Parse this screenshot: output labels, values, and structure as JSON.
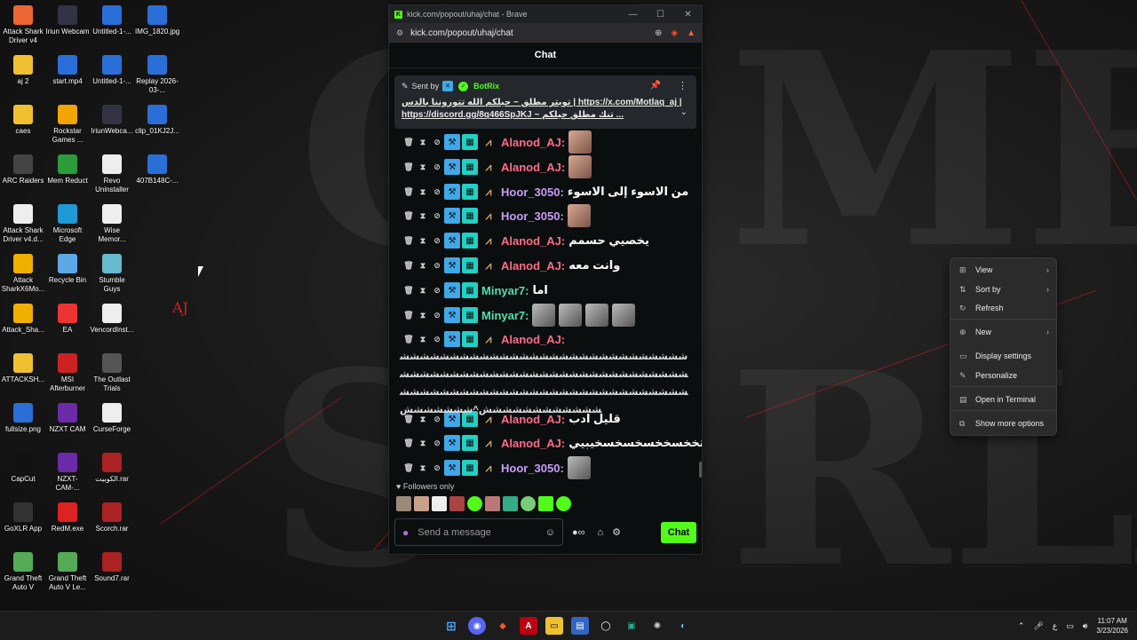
{
  "browser": {
    "title": "kick.com/popout/uhaj/chat - Brave",
    "url": "kick.com/popout/uhaj/chat",
    "minimize": "—",
    "maximize": "☐",
    "close": "✕"
  },
  "chat": {
    "header": "Chat",
    "pinned": {
      "sent_by": "Sent by",
      "bot_name": "BotRix",
      "line1": "تويتر مطلق ~ حيلكم الله تتوروننا بالدس | https://x.com/Motlaq_aj |",
      "line2": "https://discord.gg/8q466SpJKJ ~ تنك مطلق حيلكم ..."
    },
    "messages": [
      {
        "user": "Alanod_AJ:",
        "text": "",
        "emotes": 1,
        "color": "#ff6b8a"
      },
      {
        "user": "Alanod_AJ:",
        "text": "",
        "emotes": 1,
        "color": "#ff6b8a"
      },
      {
        "user": "Hoor_3050:",
        "text": "من الاسوء إلى الاسوء",
        "emotes": 0,
        "color": "#c89cf7"
      },
      {
        "user": "Hoor_3050:",
        "text": "",
        "emotes": 1,
        "color": "#c89cf7"
      },
      {
        "user": "Alanod_AJ:",
        "text": "يخصيي حسمم",
        "emotes": 0,
        "color": "#ff6b8a"
      },
      {
        "user": "Alanod_AJ:",
        "text": "وانت معه",
        "emotes": 0,
        "color": "#ff6b8a"
      },
      {
        "user": "Minyar7:",
        "text": "اما",
        "emotes": 0,
        "color": "#53e0b0"
      },
      {
        "user": "Minyar7:",
        "text": "",
        "emotes": 4,
        "color": "#53e0b0"
      },
      {
        "user": "Alanod_AJ:",
        "text": "",
        "emotes": 0,
        "color": "#ff6b8a"
      },
      {
        "user": "Alanod_AJ:",
        "text": "قليل ادب",
        "emotes": 0,
        "color": "#ff6b8a"
      },
      {
        "user": "Alanod_AJ:",
        "text": "تخخسخخسخسخسخيبيي",
        "emotes": 0,
        "color": "#ff6b8a"
      },
      {
        "user": "Hoor_3050:",
        "text": "",
        "emotes": 1,
        "color": "#c89cf7"
      }
    ],
    "long_text": "ششششششششششششششششششششششششششششششششششششششششششششششششششششششششششششششششششششششششششششششششششششششششششششششششششش^ششششششش",
    "followers_only": "Followers only",
    "input_placeholder": "Send a message",
    "chat_button": "Chat"
  },
  "context_menu": {
    "items": [
      {
        "label": "View",
        "icon": "grid-icon",
        "submenu": true
      },
      {
        "label": "Sort by",
        "icon": "sort-icon",
        "submenu": true
      },
      {
        "label": "Refresh",
        "icon": "refresh-icon",
        "submenu": false
      },
      {
        "label": "New",
        "icon": "new-icon",
        "submenu": true
      },
      {
        "label": "Display settings",
        "icon": "display-icon",
        "submenu": false
      },
      {
        "label": "Personalize",
        "icon": "brush-icon",
        "submenu": false
      },
      {
        "label": "Open in Terminal",
        "icon": "terminal-icon",
        "submenu": false
      },
      {
        "label": "Show more options",
        "icon": "more-options-icon",
        "submenu": false
      }
    ]
  },
  "desktop": {
    "icons": [
      {
        "label": "Attack Shark Driver v4",
        "color": "#e63"
      },
      {
        "label": "Iriun Webcam",
        "color": "#334"
      },
      {
        "label": "Untitled-1-...",
        "color": "#2a6fd8"
      },
      {
        "label": "IMG_1820.jpg",
        "color": "#2a6fd8"
      },
      {
        "label": "aj 2",
        "color": "#f0c030"
      },
      {
        "label": "start.mp4",
        "color": "#2a6fd8"
      },
      {
        "label": "Untitled-1-...",
        "color": "#2a6fd8"
      },
      {
        "label": "Replay 2026-03-...",
        "color": "#2a6fd8"
      },
      {
        "label": "caes",
        "color": "#f0c030"
      },
      {
        "label": "Rockstar Games ...",
        "color": "#f2a400"
      },
      {
        "label": "IriunWebca...",
        "color": "#334"
      },
      {
        "label": "clip_01KJ2J...",
        "color": "#2a6fd8"
      },
      {
        "label": "ARC Raiders",
        "color": "#444"
      },
      {
        "label": "Mem Reduct",
        "color": "#2b9c3a"
      },
      {
        "label": "Revo Uninstaller",
        "color": "#eee"
      },
      {
        "label": "407B148C-...",
        "color": "#2a6fd8"
      },
      {
        "label": "Attack Shark Driver v4.d...",
        "color": "#eee"
      },
      {
        "label": "Microsoft Edge",
        "color": "#1f9ad6"
      },
      {
        "label": "Wise Memor...",
        "color": "#eee"
      },
      {
        "label": "Attack SharkX6Mo...",
        "color": "#f0b000"
      },
      {
        "label": "Recycle Bin",
        "color": "#5fa8e8"
      },
      {
        "label": "Stumble Guys",
        "color": "#6bc"
      },
      {
        "label": "Attack_Sha...",
        "color": "#f0b000"
      },
      {
        "label": "EA",
        "color": "#e33"
      },
      {
        "label": "VencordInst...",
        "color": "#eee"
      },
      {
        "label": "ATTACKSH...",
        "color": "#f0c030"
      },
      {
        "label": "MSI Afterburner",
        "color": "#c22"
      },
      {
        "label": "The Outlast Trials",
        "color": "#555"
      },
      {
        "label": "fullsize.png",
        "color": "#2a6fd8"
      },
      {
        "label": "NZXT CAM",
        "color": "#6b2ba8"
      },
      {
        "label": "CurseForge",
        "color": "#eee"
      },
      {
        "label": "CapCut",
        "color": "#111"
      },
      {
        "label": "NZXT-CAM-...",
        "color": "#6b2ba8"
      },
      {
        "label": "الكوبيت.rar",
        "color": "#a22"
      },
      {
        "label": "GoXLR App",
        "color": "#333"
      },
      {
        "label": "RedM.exe",
        "color": "#d22"
      },
      {
        "label": "Scorch.rar",
        "color": "#a22"
      },
      {
        "label": "Grand Theft Auto V",
        "color": "#5a5"
      },
      {
        "label": "Grand Theft Auto V Le...",
        "color": "#5a5"
      },
      {
        "label": "Sound7.rar",
        "color": "#a22"
      }
    ],
    "aj_logo": "AJ"
  },
  "taskbar": {
    "clock_time": "11:07 AM",
    "clock_date": "3/23/2026",
    "lang": "ع"
  }
}
